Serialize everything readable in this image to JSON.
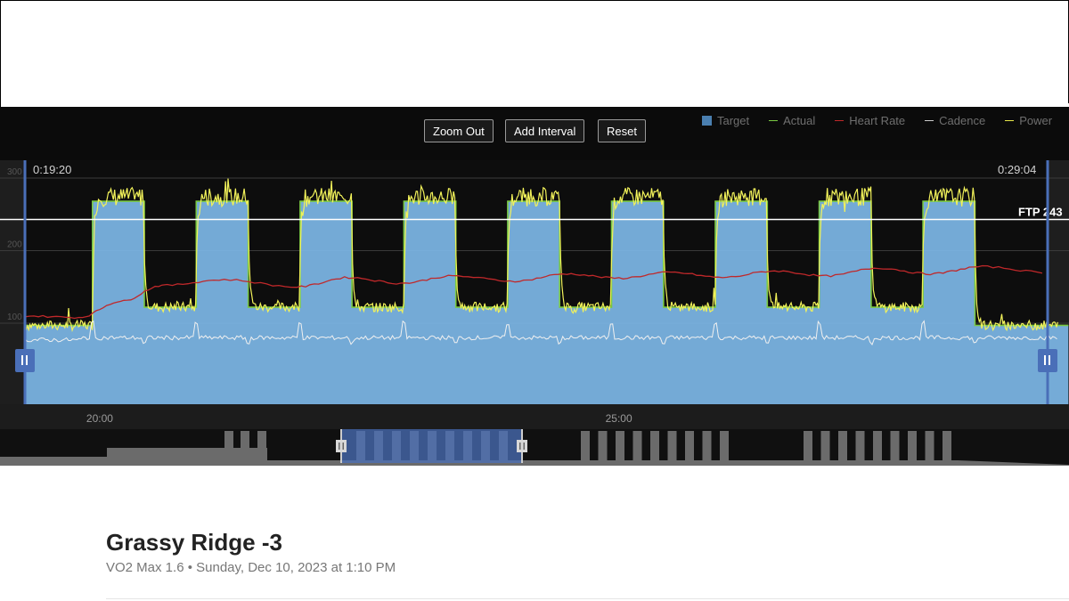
{
  "toolbar": {
    "zoom_out_label": "Zoom Out",
    "add_interval_label": "Add Interval",
    "reset_label": "Reset"
  },
  "legend": {
    "items": [
      {
        "label": "Target",
        "color": "#4a7fb0",
        "swatch": "square"
      },
      {
        "label": "Actual",
        "color": "#7ac943",
        "swatch": "line"
      },
      {
        "label": "Heart Rate",
        "color": "#c0282a",
        "swatch": "line"
      },
      {
        "label": "Cadence",
        "color": "#cccccc",
        "swatch": "line"
      },
      {
        "label": "Power",
        "color": "#e8e84a",
        "swatch": "line"
      }
    ]
  },
  "selection": {
    "start_time": "0:19:20",
    "end_time": "0:29:04"
  },
  "ftp_label": "FTP 243",
  "colors": {
    "target_fill": "#7ab3e2",
    "power_line": "#f2f25a",
    "actual_line": "#7ac943",
    "heart_rate_line": "#c0282a",
    "cadence_line": "#f0f0f0",
    "handle": "#4a6fb8",
    "background": "#0b0b0b"
  },
  "workout": {
    "title": "Grassy Ridge -3",
    "subtitle": "VO2 Max 1.6 • Sunday, Dec 10, 2023 at 1:10 PM"
  },
  "chart_data": {
    "type": "area",
    "x_unit": "minutes",
    "xlim": [
      19.28,
      29.13
    ],
    "x_ticks": [
      {
        "value": 20,
        "label": "20:00"
      },
      {
        "value": 25,
        "label": "25:00"
      }
    ],
    "y_ticks": [
      {
        "value": 100,
        "label": "100"
      },
      {
        "value": 200,
        "label": "200"
      },
      {
        "value": 300,
        "label": "300"
      }
    ],
    "ylim": [
      -115,
      315
    ],
    "ftp": 243,
    "grid": true,
    "legend_position": "top-right",
    "intervals": {
      "warmup_level": 97,
      "on_level": 268,
      "recovery_level": 122,
      "on_duration": 0.5,
      "recovery_duration": 0.5,
      "starts": [
        19.93,
        20.93,
        21.93,
        22.93,
        23.93,
        24.93,
        25.93,
        26.93,
        27.93
      ],
      "end": 28.43,
      "final_level": 97
    },
    "series": [
      {
        "name": "Target",
        "source": "intervals"
      },
      {
        "name": "Heart Rate",
        "values_by_x": [
          [
            19.28,
            110
          ],
          [
            19.8,
            108
          ],
          [
            20.2,
            130
          ],
          [
            20.6,
            152
          ],
          [
            21.2,
            160
          ],
          [
            21.9,
            150
          ],
          [
            22.4,
            163
          ],
          [
            22.9,
            155
          ],
          [
            23.4,
            165
          ],
          [
            24.0,
            158
          ],
          [
            24.5,
            168
          ],
          [
            25.0,
            162
          ],
          [
            25.5,
            170
          ],
          [
            26.0,
            163
          ],
          [
            26.5,
            172
          ],
          [
            27.0,
            165
          ],
          [
            27.5,
            176
          ],
          [
            28.0,
            168
          ],
          [
            28.5,
            178
          ],
          [
            29.13,
            170
          ]
        ]
      },
      {
        "name": "Cadence",
        "base": 77
      },
      {
        "name": "Power",
        "source": "intervals_noisy"
      }
    ]
  },
  "minimap": {
    "blocks_note": ""
  }
}
